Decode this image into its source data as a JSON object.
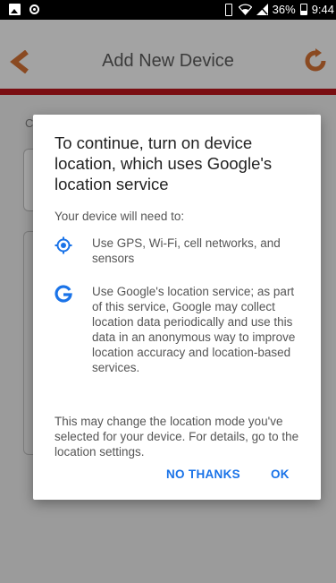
{
  "status_bar": {
    "battery": "36%",
    "time": "9:44"
  },
  "app_bar": {
    "title": "Add New Device"
  },
  "background": {
    "letter": "C"
  },
  "dialog": {
    "title": "To continue, turn on device location, which uses Google's location service",
    "subtitle": "Your device will need to:",
    "items": [
      {
        "icon": "gps-icon",
        "text": "Use GPS, Wi-Fi, cell networks, and sensors"
      },
      {
        "icon": "google-icon",
        "text": "Use Google's location service; as part of this service, Google may collect location data periodically and use this data in an anonymous way to improve location accuracy and location-based services."
      }
    ],
    "note": "This may change the location mode you've selected for your device. For details, go to the location settings.",
    "buttons": {
      "no_thanks": "NO THANKS",
      "ok": "OK"
    }
  },
  "colors": {
    "accent": "#1a73e8",
    "brand_red": "#7a0e12",
    "brand_orange": "#c0521a"
  }
}
